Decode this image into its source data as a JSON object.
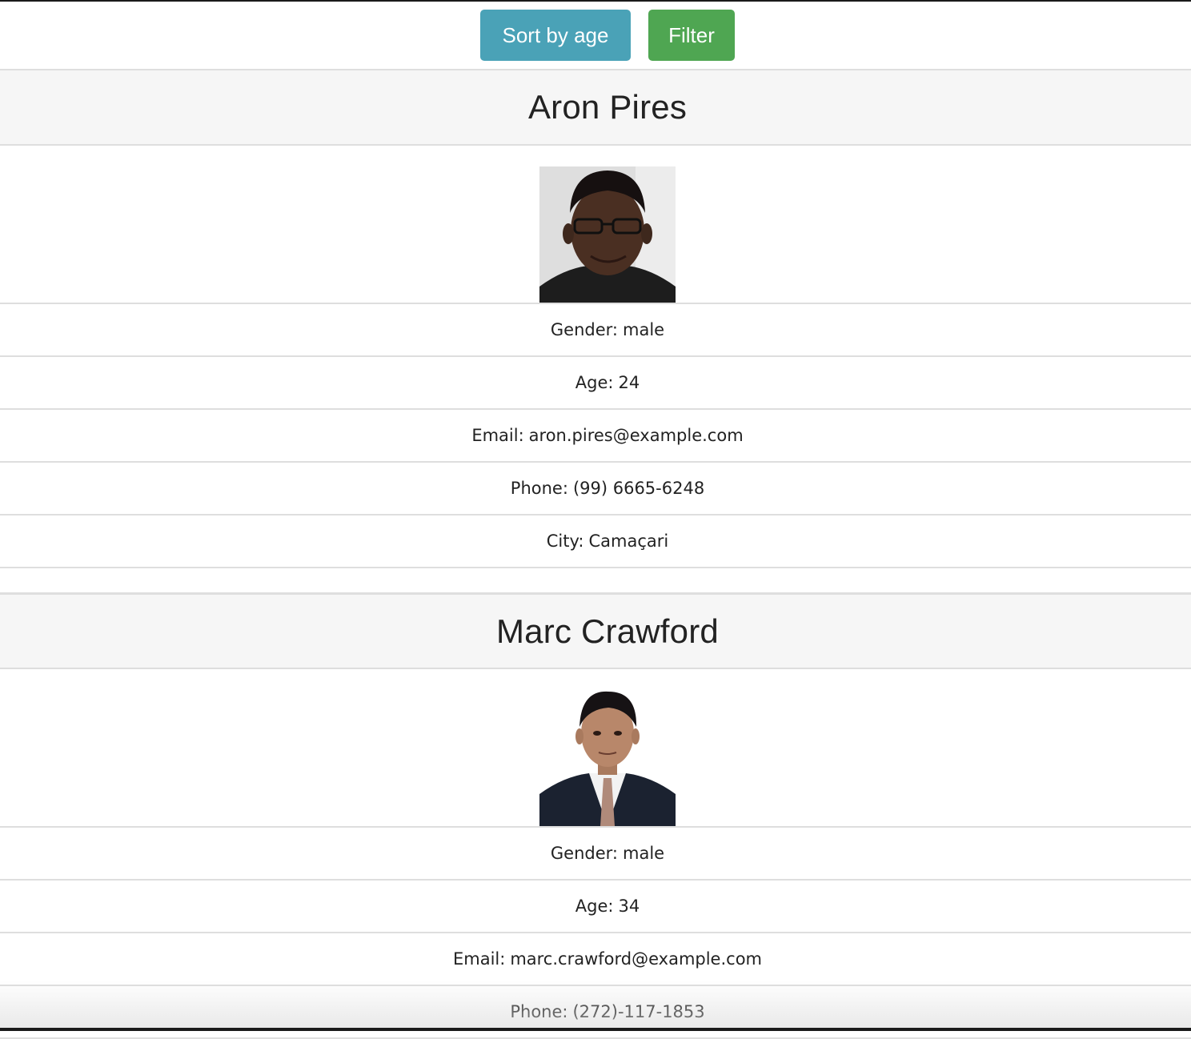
{
  "toolbar": {
    "sort_label": "Sort by age",
    "filter_label": "Filter",
    "sort_color": "#4aa2b7",
    "filter_color": "#4fa652"
  },
  "people": [
    {
      "name": "Aron Pires",
      "photo_alt": "Aron Pires",
      "gender_label": "Gender:",
      "gender": "male",
      "age_label": "Age:",
      "age": "24",
      "email_label": "Email:",
      "email": "aron.pires@example.com",
      "phone_label": "Phone:",
      "phone": "(99) 6665-6248",
      "city_label": "City:",
      "city": "Camaçari"
    },
    {
      "name": "Marc Crawford",
      "photo_alt": "Marc Crawford",
      "gender_label": "Gender:",
      "gender": "male",
      "age_label": "Age:",
      "age": "34",
      "email_label": "Email:",
      "email": "marc.crawford@example.com",
      "phone_label": "Phone:",
      "phone": "(272)-117-1853"
    }
  ]
}
